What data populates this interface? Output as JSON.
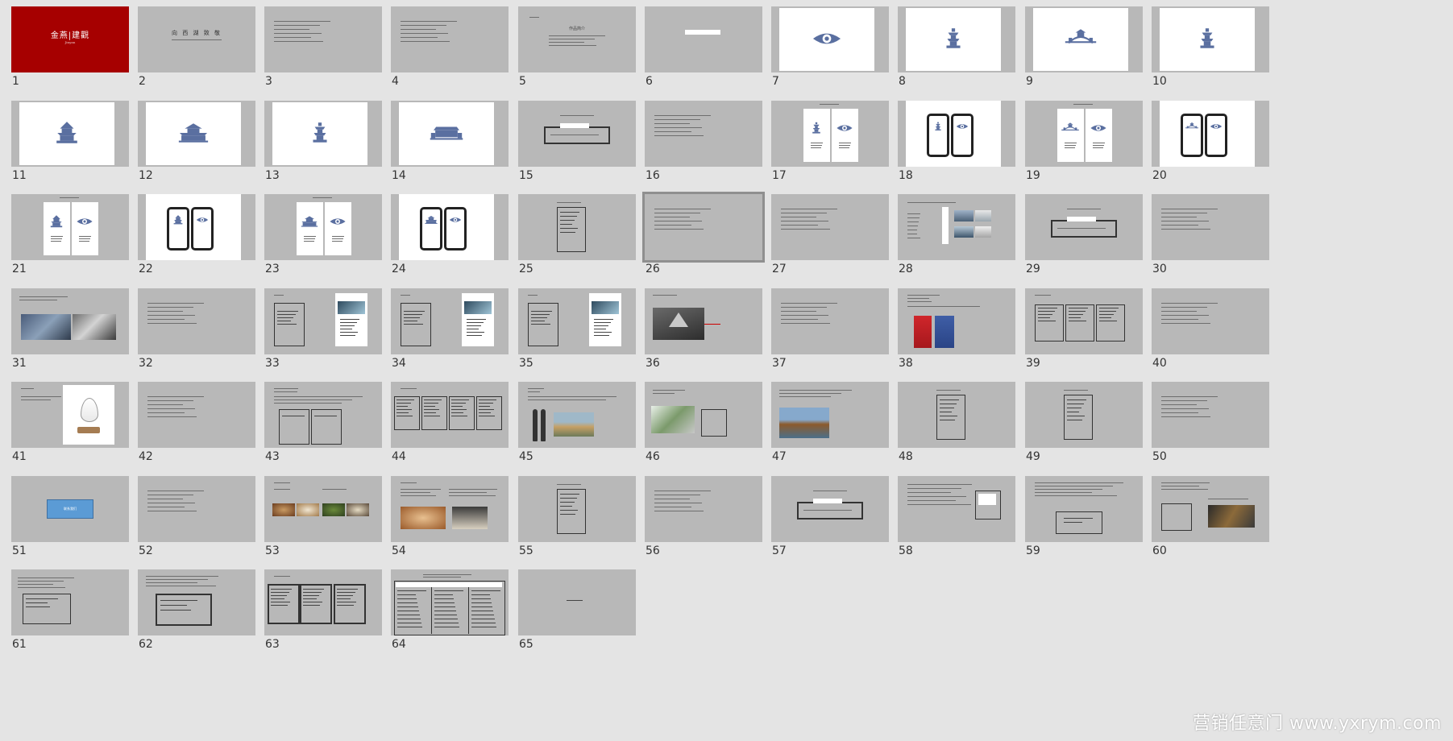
{
  "slides": [
    {
      "n": "1",
      "type": "title-red",
      "title": "金燕|建觀",
      "subtitle": "Jinyan"
    },
    {
      "n": "2",
      "type": "title-plain",
      "title": "向 西 湖 致 敬"
    },
    {
      "n": "3",
      "type": "text-lines"
    },
    {
      "n": "4",
      "type": "text-lines"
    },
    {
      "n": "5",
      "type": "text-center",
      "title": "作品简介"
    },
    {
      "n": "6",
      "type": "label"
    },
    {
      "n": "7",
      "type": "white-icon",
      "icon": "eye"
    },
    {
      "n": "8",
      "type": "white-icon",
      "icon": "pagoda"
    },
    {
      "n": "9",
      "type": "white-icon",
      "icon": "bridge"
    },
    {
      "n": "10",
      "type": "white-icon",
      "icon": "pagoda"
    },
    {
      "n": "11",
      "type": "white-icon",
      "icon": "tower"
    },
    {
      "n": "12",
      "type": "white-icon",
      "icon": "temple"
    },
    {
      "n": "13",
      "type": "white-icon",
      "icon": "pagoda"
    },
    {
      "n": "14",
      "type": "white-icon",
      "icon": "hall"
    },
    {
      "n": "15",
      "type": "center-box"
    },
    {
      "n": "16",
      "type": "text-lines"
    },
    {
      "n": "17",
      "type": "two-cards",
      "icons": [
        "pagoda",
        "eye"
      ]
    },
    {
      "n": "18",
      "type": "two-phones",
      "icons": [
        "pagoda",
        "eye"
      ]
    },
    {
      "n": "19",
      "type": "two-cards",
      "icons": [
        "bridge",
        "eye"
      ]
    },
    {
      "n": "20",
      "type": "two-phones",
      "icons": [
        "bridge",
        "eye"
      ]
    },
    {
      "n": "21",
      "type": "two-cards",
      "icons": [
        "tower",
        "eye"
      ]
    },
    {
      "n": "22",
      "type": "two-phones",
      "icons": [
        "tower",
        "eye"
      ]
    },
    {
      "n": "23",
      "type": "two-cards",
      "icons": [
        "temple",
        "eye"
      ]
    },
    {
      "n": "24",
      "type": "two-phones",
      "icons": [
        "temple",
        "eye"
      ]
    },
    {
      "n": "25",
      "type": "tall-box"
    },
    {
      "n": "26",
      "type": "text-lines",
      "selected": true
    },
    {
      "n": "27",
      "type": "text-lines"
    },
    {
      "n": "28",
      "type": "photos-small"
    },
    {
      "n": "29",
      "type": "center-box"
    },
    {
      "n": "30",
      "type": "text-lines"
    },
    {
      "n": "31",
      "type": "photos-wide"
    },
    {
      "n": "32",
      "type": "text-lines"
    },
    {
      "n": "33",
      "type": "box-card"
    },
    {
      "n": "34",
      "type": "box-card"
    },
    {
      "n": "35",
      "type": "box-card"
    },
    {
      "n": "36",
      "type": "photo-sign"
    },
    {
      "n": "37",
      "type": "text-lines"
    },
    {
      "n": "38",
      "type": "red-cards"
    },
    {
      "n": "39",
      "type": "three-boxes"
    },
    {
      "n": "40",
      "type": "text-lines"
    },
    {
      "n": "41",
      "type": "drop"
    },
    {
      "n": "42",
      "type": "text-lines"
    },
    {
      "n": "43",
      "type": "two-boxes"
    },
    {
      "n": "44",
      "type": "four-boxes"
    },
    {
      "n": "45",
      "type": "spoon-photo"
    },
    {
      "n": "46",
      "type": "photo-box"
    },
    {
      "n": "47",
      "type": "boat-photo"
    },
    {
      "n": "48",
      "type": "tall-box"
    },
    {
      "n": "49",
      "type": "tall-box"
    },
    {
      "n": "50",
      "type": "text-lines"
    },
    {
      "n": "51",
      "type": "blue-button",
      "label": "联系我们"
    },
    {
      "n": "52",
      "type": "text-lines"
    },
    {
      "n": "53",
      "type": "food-photos"
    },
    {
      "n": "54",
      "type": "food-photos2"
    },
    {
      "n": "55",
      "type": "tall-box"
    },
    {
      "n": "56",
      "type": "text-lines"
    },
    {
      "n": "57",
      "type": "center-box"
    },
    {
      "n": "58",
      "type": "small-box"
    },
    {
      "n": "59",
      "type": "mid-box"
    },
    {
      "n": "60",
      "type": "box-photo"
    },
    {
      "n": "61",
      "type": "low-box"
    },
    {
      "n": "62",
      "type": "low-box2"
    },
    {
      "n": "63",
      "type": "three-tall"
    },
    {
      "n": "64",
      "type": "table"
    },
    {
      "n": "65",
      "type": "blank-text"
    }
  ],
  "watermark": "营销任意门 www.yxrym.com",
  "colors": {
    "thumb_bg": "#b8b8b8",
    "page_bg": "#e4e4e4",
    "brand_red": "#a60000",
    "icon_blue": "#5a6fa0",
    "button_blue": "#5b9bd5"
  }
}
